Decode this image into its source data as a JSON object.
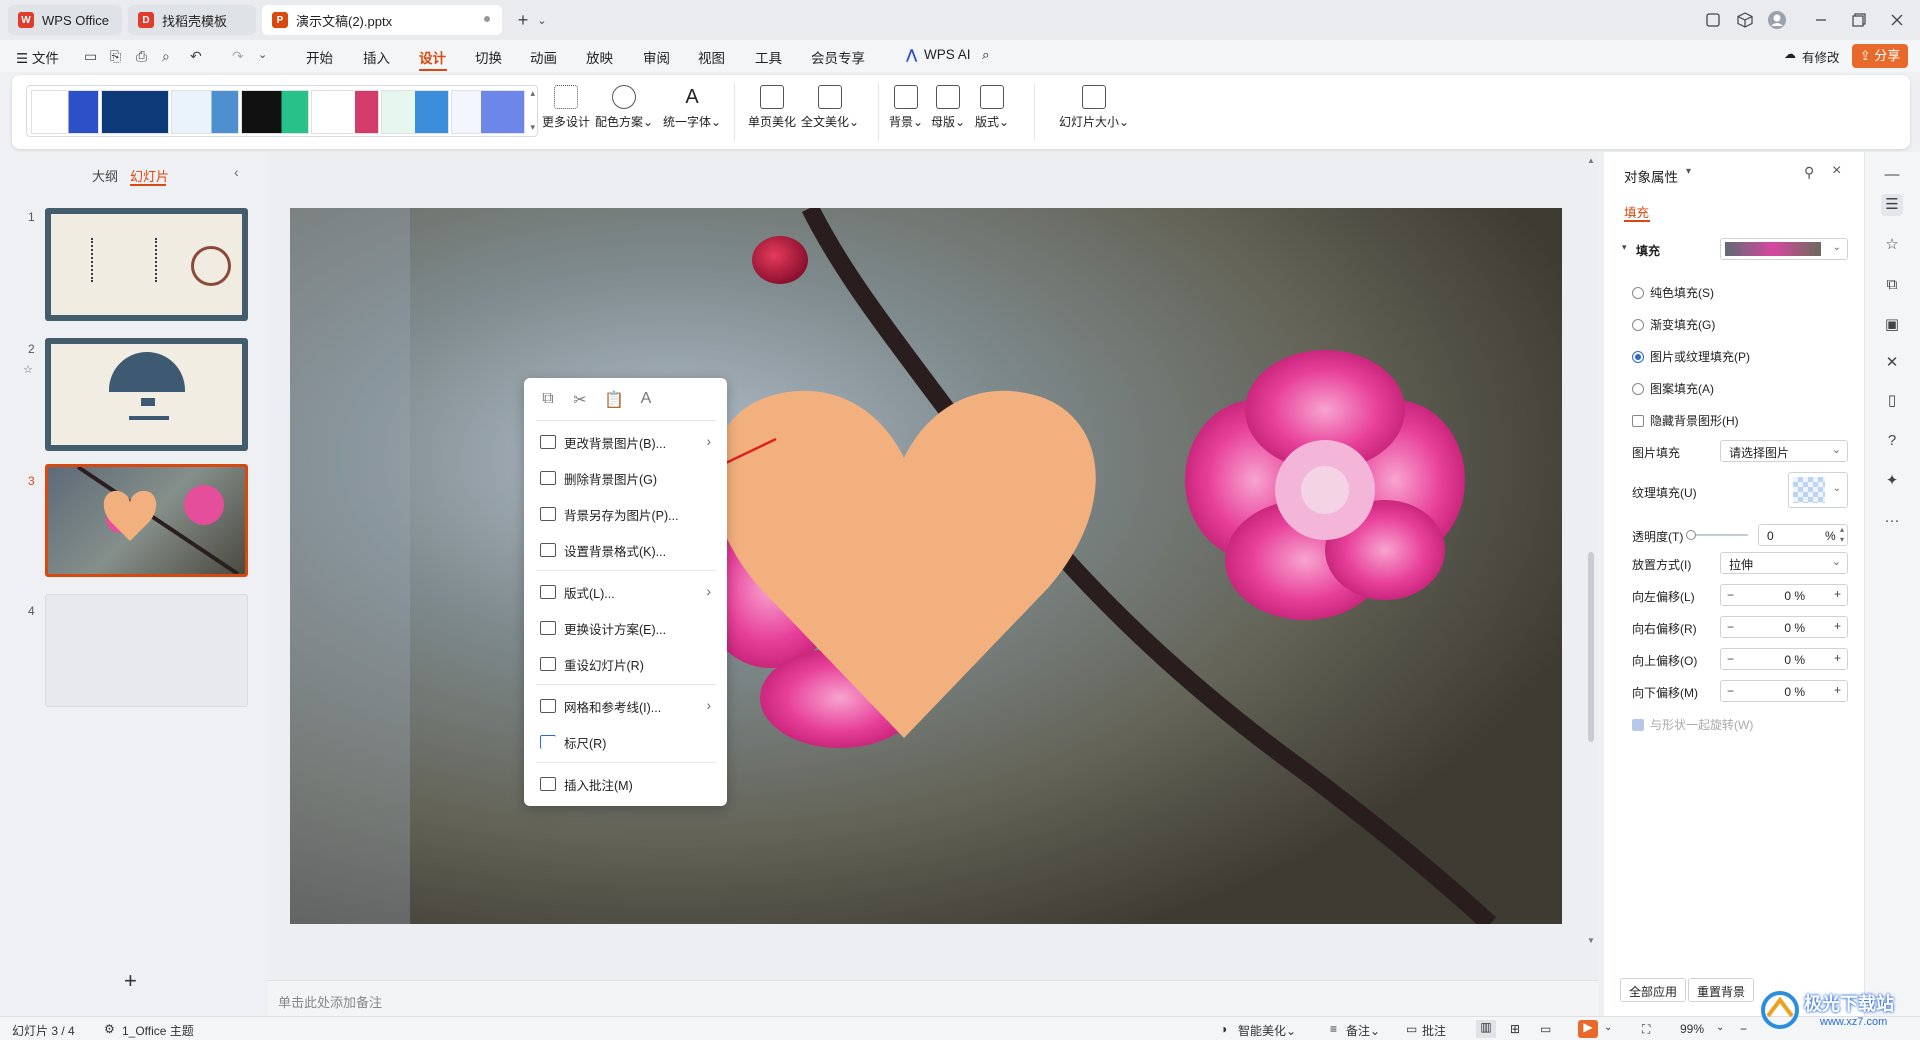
{
  "titlebar": {
    "tabs": [
      {
        "label": "WPS Office",
        "icon": "wps-logo-icon"
      },
      {
        "label": "找稻壳模板",
        "icon": "docer-icon"
      },
      {
        "label": "演示文稿(2).pptx",
        "icon": "presentation-file-icon"
      }
    ],
    "new_tab": "+",
    "new_tab_menu": "⌄",
    "window_controls": [
      "restore-icon",
      "box-icon",
      "avatar",
      "minimize-icon",
      "maximize-icon",
      "close-icon"
    ]
  },
  "menubar": {
    "file_label": "☰ 文件",
    "items": [
      "开始",
      "插入",
      "设计",
      "切换",
      "动画",
      "放映",
      "审阅",
      "视图",
      "工具",
      "会员专享"
    ],
    "active_item": "设计",
    "wps_ai": "WPS AI",
    "modified_label": "有修改",
    "share_label": "分享"
  },
  "ribbon": {
    "buttons": [
      {
        "label": "更多设计",
        "icon": "grid-design-icon"
      },
      {
        "label": "配色方案⌄",
        "icon": "palette-icon"
      },
      {
        "label": "统一字体⌄",
        "icon": "font-icon"
      },
      {
        "label": "单页美化",
        "icon": "single-page-beautify-icon"
      },
      {
        "label": "全文美化⌄",
        "icon": "full-beautify-icon"
      },
      {
        "label": "背景⌄",
        "icon": "background-icon"
      },
      {
        "label": "母版⌄",
        "icon": "master-icon"
      },
      {
        "label": "版式⌄",
        "icon": "layout-icon"
      },
      {
        "label": "幻灯片大小⌄",
        "icon": "slide-size-icon"
      }
    ]
  },
  "leftpanel": {
    "tabs": [
      "大纲",
      "幻灯片"
    ],
    "active_tab": "幻灯片",
    "slides": [
      "1",
      "2",
      "3",
      "4"
    ],
    "selected_slide": "3",
    "add_button": "+"
  },
  "notes": {
    "placeholder": "单击此处添加备注"
  },
  "context_menu": {
    "quick_icons": [
      "copy-icon",
      "cut-icon",
      "paste-icon",
      "paste-text-icon"
    ],
    "items": [
      {
        "label": "更改背景图片(B)...",
        "submenu": true
      },
      {
        "label": "删除背景图片(G)",
        "submenu": false
      },
      {
        "label": "背景另存为图片(P)...",
        "submenu": false
      },
      {
        "label": "设置背景格式(K)...",
        "submenu": false
      },
      {
        "label": "版式(L)...",
        "submenu": true
      },
      {
        "label": "更换设计方案(E)...",
        "submenu": false
      },
      {
        "label": "重设幻灯片(R)",
        "submenu": false
      },
      {
        "label": "网格和参考线(I)...",
        "submenu": true
      },
      {
        "label": "标尺(R)",
        "submenu": false
      },
      {
        "label": "插入批注(M)",
        "submenu": false
      }
    ]
  },
  "rightpanel": {
    "title": "对象属性",
    "tab": "填充",
    "section": "填充",
    "fill_options": [
      {
        "label": "纯色填充(S)",
        "checked": false
      },
      {
        "label": "渐变填充(G)",
        "checked": false
      },
      {
        "label": "图片或纹理填充(P)",
        "checked": true
      },
      {
        "label": "图案填充(A)",
        "checked": false
      }
    ],
    "hide_bg_graphics": "隐藏背景图形(H)",
    "picture_fill_label": "图片填充",
    "picture_fill_value": "请选择图片",
    "texture_fill_label": "纹理填充(U)",
    "transparency_label": "透明度(T)",
    "transparency_value": "0",
    "percent": "%",
    "placement_label": "放置方式(I)",
    "placement_value": "拉伸",
    "offsets": [
      {
        "label": "向左偏移(L)",
        "value": "0 %"
      },
      {
        "label": "向右偏移(R)",
        "value": "0 %"
      },
      {
        "label": "向上偏移(O)",
        "value": "0 %"
      },
      {
        "label": "向下偏移(M)",
        "value": "0 %"
      }
    ],
    "rotate_with_shape": "与形状一起旋转(W)",
    "apply_all": "全部应用",
    "reset_bg": "重置背景"
  },
  "statusbar": {
    "slide_info": "幻灯片 3 / 4",
    "theme": "1_Office 主题",
    "smart_beautify": "智能美化⌄",
    "notes": "备注⌄",
    "comments": "批注",
    "zoom": "99%"
  },
  "watermark": {
    "text": "极光下载站",
    "url": "www.xz7.com"
  },
  "colors": {
    "accent": "#d9480f",
    "heart": "#f2b07e",
    "blossom": "#e8409a"
  }
}
